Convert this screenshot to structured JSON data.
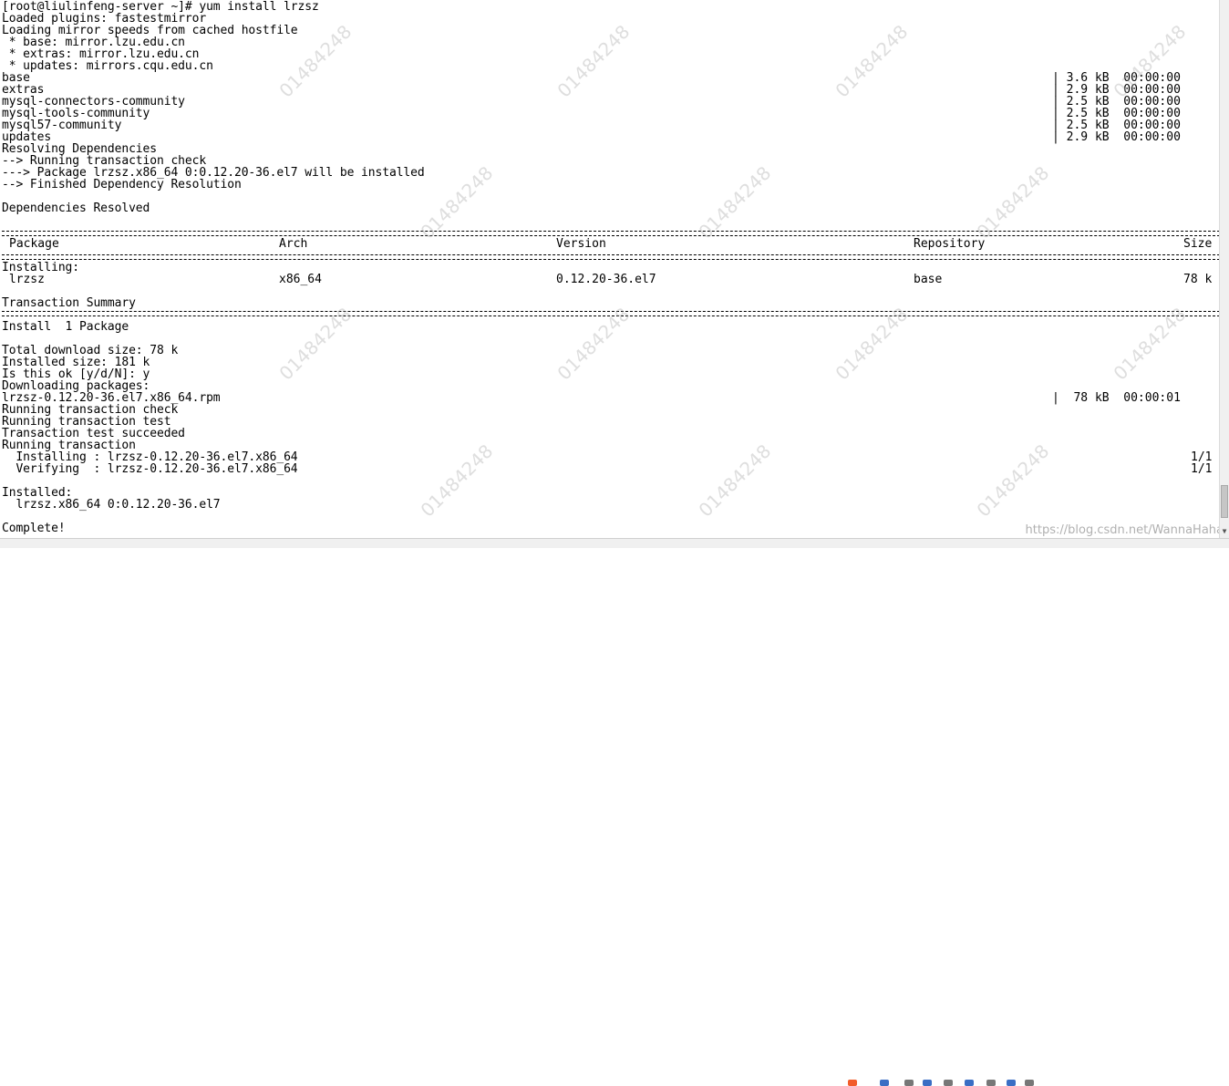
{
  "terminal": {
    "lines": [
      "[root@liulinfeng-server ~]# yum install lrzsz",
      "Loaded plugins: fastestmirror",
      "Loading mirror speeds from cached hostfile",
      " * base: mirror.lzu.edu.cn",
      " * extras: mirror.lzu.edu.cn",
      " * updates: mirrors.cqu.edu.cn",
      "base",
      "extras",
      "mysql-connectors-community",
      "mysql-tools-community",
      "mysql57-community",
      "updates",
      "Resolving Dependencies",
      "--> Running transaction check",
      "---> Package lrzsz.x86_64 0:0.12.20-36.el7 will be installed",
      "--> Finished Dependency Resolution",
      "",
      "Dependencies Resolved",
      "",
      "",
      "",
      "",
      "Installing:",
      "",
      "",
      "Transaction Summary",
      "",
      "Install  1 Package",
      "",
      "Total download size: 78 k",
      "Installed size: 181 k",
      "Is this ok [y/d/N]: y",
      "Downloading packages:",
      "lrzsz-0.12.20-36.el7.x86_64.rpm",
      "Running transaction check",
      "Running transaction test",
      "Transaction test succeeded",
      "Running transaction",
      "  Installing : lrzsz-0.12.20-36.el7.x86_64",
      "  Verifying  : lrzsz-0.12.20-36.el7.x86_64",
      "",
      "Installed:",
      "  lrzsz.x86_64 0:0.12.20-36.el7",
      "",
      "Complete!"
    ],
    "repo_stats": [
      {
        "size": "| 3.6 kB",
        "time": "00:00:00"
      },
      {
        "size": "| 2.9 kB",
        "time": "00:00:00"
      },
      {
        "size": "| 2.5 kB",
        "time": "00:00:00"
      },
      {
        "size": "| 2.5 kB",
        "time": "00:00:00"
      },
      {
        "size": "| 2.5 kB",
        "time": "00:00:00"
      },
      {
        "size": "| 2.9 kB",
        "time": "00:00:00"
      }
    ],
    "table": {
      "headers": [
        "Package",
        "Arch",
        "Version",
        "Repository",
        "Size"
      ],
      "row": [
        " lrzsz",
        "x86_64",
        "0.12.20-36.el7",
        "base",
        "78 k"
      ]
    },
    "download_stat": {
      "size": "|  78 kB",
      "time": "00:00:01"
    },
    "progress": [
      "1/1",
      "1/1"
    ]
  },
  "watermark": {
    "text": "01484248",
    "blog": "https://blog.csdn.net/WannaHaha"
  }
}
